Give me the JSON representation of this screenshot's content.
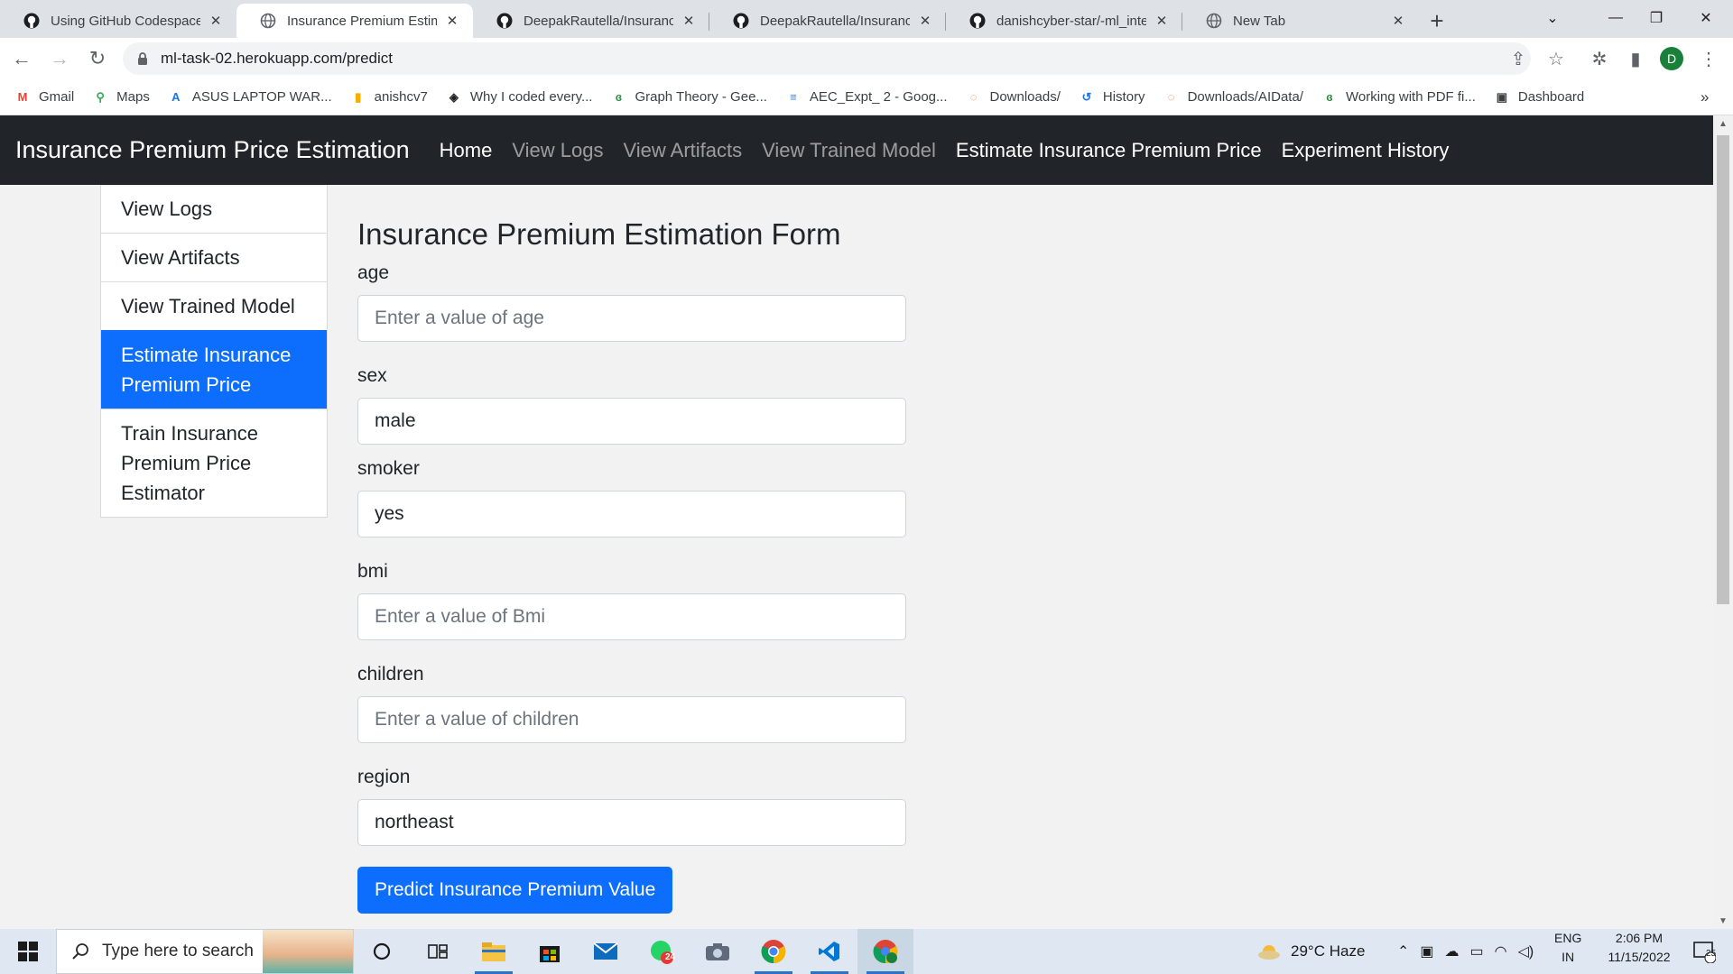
{
  "browser": {
    "tabs": [
      {
        "title": "Using GitHub Codespaces i",
        "favicon": "github-icon",
        "active": false
      },
      {
        "title": "Insurance Premium Estimat",
        "favicon": "globe-icon",
        "active": true
      },
      {
        "title": "DeepakRautella/Insurance_",
        "favicon": "github-icon",
        "active": false
      },
      {
        "title": "DeepakRautella/Insurance_",
        "favicon": "github-icon",
        "active": false
      },
      {
        "title": "danishcyber-star/-ml_intern",
        "favicon": "github-icon",
        "active": false
      },
      {
        "title": "New Tab",
        "favicon": "globe-icon",
        "active": false
      }
    ],
    "close_glyph": "✕",
    "new_tab_glyph": "+",
    "url": "ml-task-02.herokuapp.com/predict",
    "profile_initial": "D",
    "bookmarks": [
      {
        "label": "Gmail",
        "icon": "gmail-icon",
        "color": "#ea4335",
        "glyph": "M"
      },
      {
        "label": "Maps",
        "icon": "maps-icon",
        "color": "#34a853",
        "glyph": "⚲"
      },
      {
        "label": "ASUS LAPTOP WAR...",
        "icon": "asus-icon",
        "color": "#1a73e8",
        "glyph": "A"
      },
      {
        "label": "anishcv7",
        "icon": "bar-chart-icon",
        "color": "#f9ab00",
        "glyph": "▮"
      },
      {
        "label": "Why I coded every...",
        "icon": "article-icon",
        "color": "#202124",
        "glyph": "◈"
      },
      {
        "label": "Graph Theory - Gee...",
        "icon": "gfg-icon",
        "color": "#2f8d46",
        "glyph": "ɞ"
      },
      {
        "label": "AEC_Expt_ 2 - Goog...",
        "icon": "docs-icon",
        "color": "#4285f4",
        "glyph": "≡"
      },
      {
        "label": "Downloads/",
        "icon": "jupyter-icon",
        "color": "#f37726",
        "glyph": "◌"
      },
      {
        "label": "History",
        "icon": "history-icon",
        "color": "#1a73e8",
        "glyph": "↺"
      },
      {
        "label": "Downloads/AIData/",
        "icon": "jupyter-icon",
        "color": "#f37726",
        "glyph": "◌"
      },
      {
        "label": "Working with PDF fi...",
        "icon": "gfg-icon",
        "color": "#2f8d46",
        "glyph": "ɞ"
      },
      {
        "label": "Dashboard",
        "icon": "dashboard-icon",
        "color": "#3c4043",
        "glyph": "▣"
      }
    ],
    "bookmarks_overflow": "»"
  },
  "navbar": {
    "brand": "Insurance Premium Price Estimation",
    "links": [
      {
        "label": "Home",
        "active": true
      },
      {
        "label": "View Logs",
        "active": false
      },
      {
        "label": "View Artifacts",
        "active": false
      },
      {
        "label": "View Trained Model",
        "active": false
      },
      {
        "label": "Estimate Insurance Premium Price",
        "active": true
      },
      {
        "label": "Experiment History",
        "active": true
      }
    ]
  },
  "sidebar": {
    "items": [
      {
        "label": "View Logs",
        "active": false
      },
      {
        "label": "View Artifacts",
        "active": false
      },
      {
        "label": "View Trained Model",
        "active": false
      },
      {
        "label": "Estimate Insurance Premium Price",
        "active": true
      },
      {
        "label": "Train Insurance Premium Price Estimator",
        "active": false
      }
    ]
  },
  "form": {
    "title": "Insurance Premium Estimation Form",
    "fields": {
      "age": {
        "label": "age",
        "value": "",
        "placeholder": "Enter a value of age"
      },
      "sex": {
        "label": "sex",
        "value": "male",
        "placeholder": ""
      },
      "smoker": {
        "label": "smoker",
        "value": "yes",
        "placeholder": ""
      },
      "bmi": {
        "label": "bmi",
        "value": "",
        "placeholder": "Enter a value of Bmi"
      },
      "children": {
        "label": "children",
        "value": "",
        "placeholder": "Enter a value of children"
      },
      "region": {
        "label": "region",
        "value": "northeast",
        "placeholder": ""
      }
    },
    "submit_label": "Predict Insurance Premium Value"
  },
  "taskbar": {
    "search_placeholder": "Type here to search",
    "weather": "29°C  Haze",
    "language_top": "ENG",
    "language_bottom": "IN",
    "time": "2:06 PM",
    "date": "11/15/2022",
    "notification_count": "25",
    "whatsapp_badge": "24"
  },
  "colors": {
    "navbar_bg": "#212529",
    "accent": "#0d6efd"
  }
}
